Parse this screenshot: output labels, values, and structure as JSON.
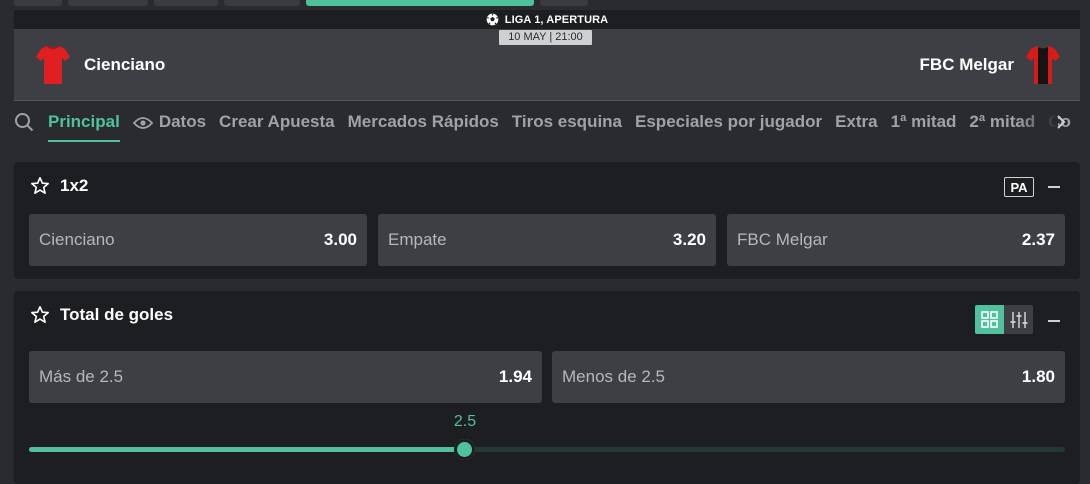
{
  "colors": {
    "accent": "#4fc29b",
    "panel": "#1d1e21",
    "page": "#2a2b2e",
    "cell": "#3d3f44"
  },
  "match": {
    "league": "LIGA 1, APERTURA",
    "date": "10 MAY | 21:00",
    "home_team": "Cienciano",
    "away_team": "FBC Melgar"
  },
  "nav": {
    "search_icon": "search-icon",
    "tabs": [
      {
        "label": "Principal",
        "active": true
      },
      {
        "label": "Datos",
        "icon": "eye-icon"
      },
      {
        "label": "Crear Apuesta"
      },
      {
        "label": "Mercados Rápidos"
      },
      {
        "label": "Tiros esquina"
      },
      {
        "label": "Especiales por jugador"
      },
      {
        "label": "Extra"
      },
      {
        "label": "1ª mitad"
      },
      {
        "label": "2ª mitad"
      },
      {
        "label": "Co"
      }
    ]
  },
  "markets": {
    "one_x_two": {
      "title": "1x2",
      "badge": "PA",
      "outcomes": [
        {
          "label": "Cienciano",
          "price": "3.00"
        },
        {
          "label": "Empate",
          "price": "3.20"
        },
        {
          "label": "FBC Melgar",
          "price": "2.37"
        }
      ]
    },
    "total_goals": {
      "title": "Total de goles",
      "outcomes": [
        {
          "label": "Más de 2.5",
          "price": "1.94"
        },
        {
          "label": "Menos de 2.5",
          "price": "1.80"
        }
      ],
      "slider": {
        "value_label": "2.5",
        "position_fraction": 0.42
      }
    }
  }
}
